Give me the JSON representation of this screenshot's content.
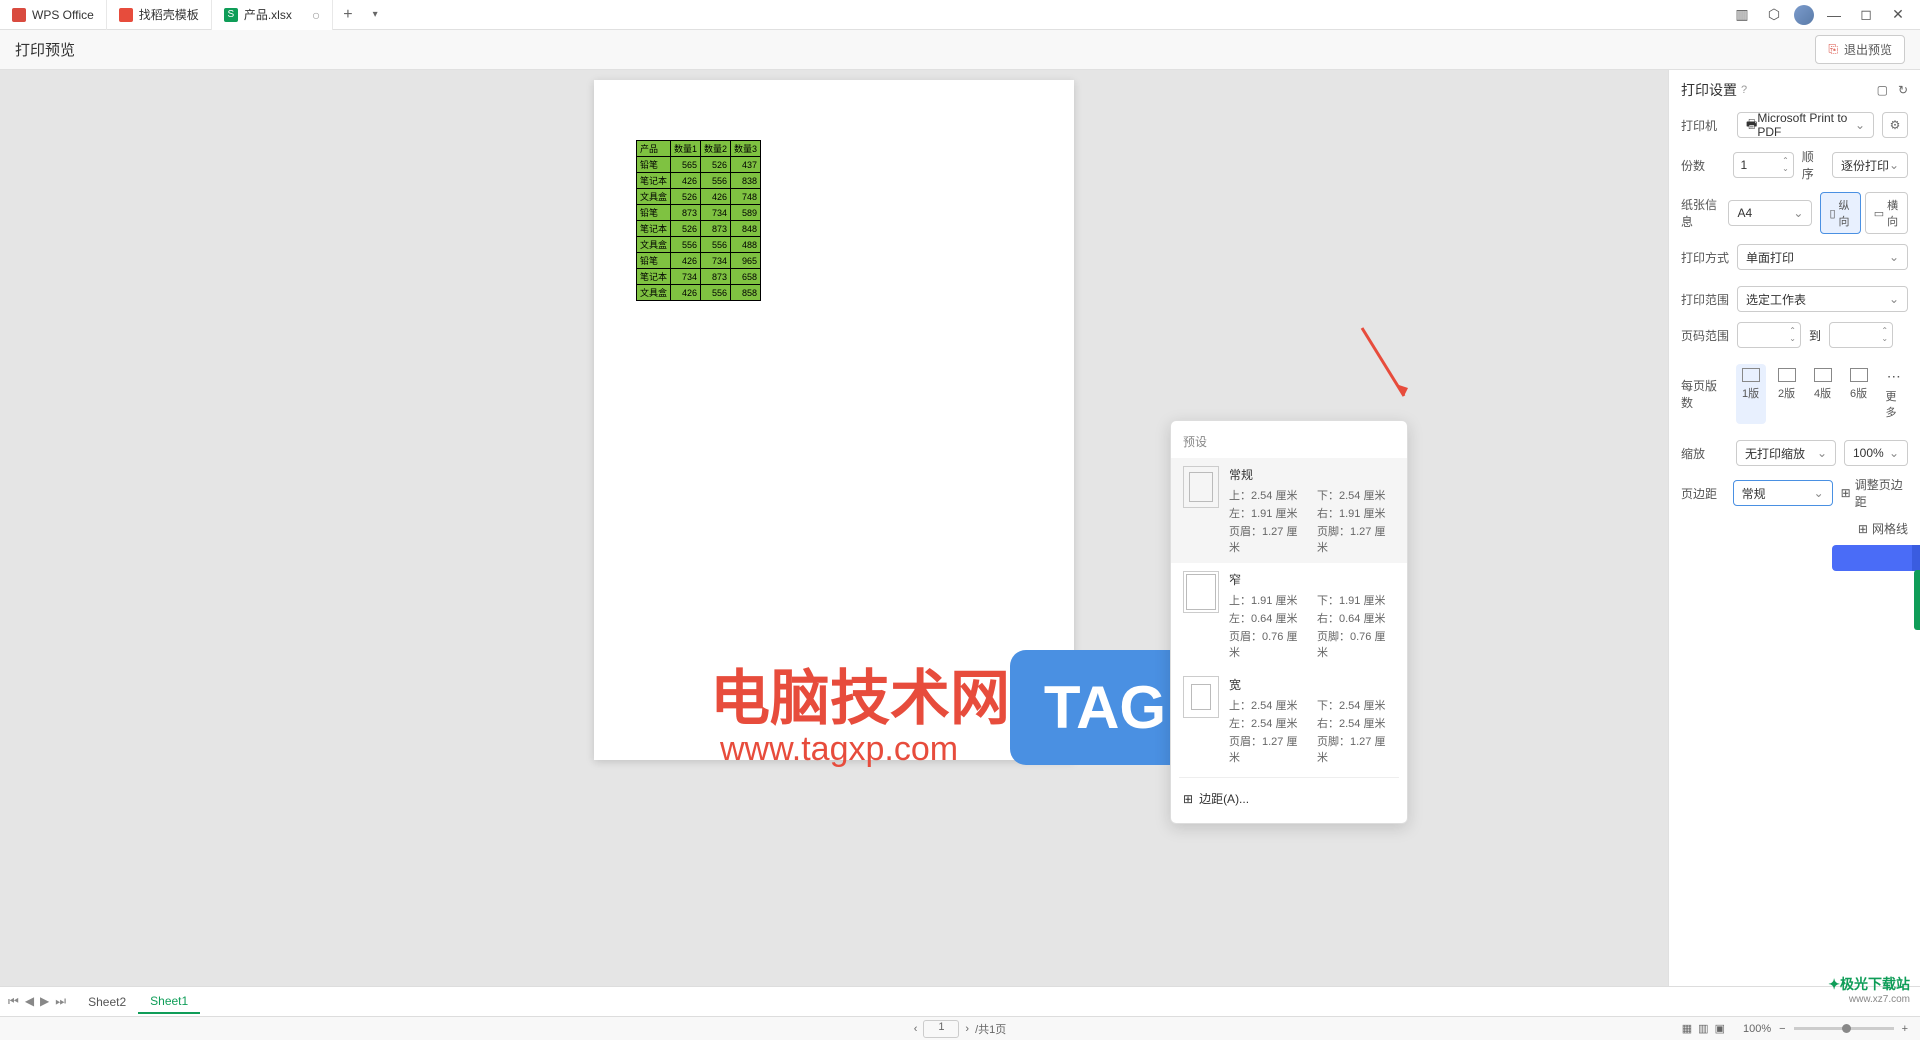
{
  "titlebar": {
    "app": "WPS Office",
    "tab2": "找稻壳模板",
    "tab3": "产品.xlsx"
  },
  "header": {
    "title": "打印预览",
    "exit": "退出预览"
  },
  "panel": {
    "title": "打印设置",
    "printer_label": "打印机",
    "printer": "Microsoft Print to PDF",
    "copies_label": "份数",
    "copies": "1",
    "order_label": "顺序",
    "order": "逐份打印",
    "paper_label": "纸张信息",
    "paper": "A4",
    "portrait": "纵向",
    "landscape": "横向",
    "mode_label": "打印方式",
    "mode": "单面打印",
    "range_label": "打印范围",
    "range": "选定工作表",
    "pages_label": "页码范围",
    "to": "到",
    "layouts_label": "每页版数",
    "l1": "1版",
    "l2": "2版",
    "l4": "4版",
    "l6": "6版",
    "lmore": "更多",
    "scale_label": "缩放",
    "scale": "无打印缩放",
    "zoom": "100%",
    "margin_label": "页边距",
    "margin": "常规",
    "margin_adj": "调整页边距",
    "grid": "网格线"
  },
  "dropdown": {
    "head": "预设",
    "normal": {
      "name": "常规",
      "t": "上：2.54 厘米",
      "b": "下：2.54 厘米",
      "l": "左：1.91 厘米",
      "r": "右：1.91 厘米",
      "h": "页眉：1.27 厘米",
      "f": "页脚：1.27 厘米"
    },
    "narrow": {
      "name": "窄",
      "t": "上：1.91 厘米",
      "b": "下：1.91 厘米",
      "l": "左：0.64 厘米",
      "r": "右：0.64 厘米",
      "h": "页眉：0.76 厘米",
      "f": "页脚：0.76 厘米"
    },
    "wide": {
      "name": "宽",
      "t": "上：2.54 厘米",
      "b": "下：2.54 厘米",
      "l": "左：2.54 厘米",
      "r": "右：2.54 厘米",
      "h": "页眉：1.27 厘米",
      "f": "页脚：1.27 厘米"
    },
    "custom": "边距(A)..."
  },
  "table": {
    "headers": [
      "产品",
      "数量1",
      "数量2",
      "数量3"
    ],
    "rows": [
      [
        "铅笔",
        "565",
        "526",
        "437"
      ],
      [
        "笔记本",
        "426",
        "556",
        "838"
      ],
      [
        "文具盒",
        "526",
        "426",
        "748"
      ],
      [
        "铅笔",
        "873",
        "734",
        "589"
      ],
      [
        "笔记本",
        "526",
        "873",
        "848"
      ],
      [
        "文具盒",
        "556",
        "556",
        "488"
      ],
      [
        "铅笔",
        "426",
        "734",
        "965"
      ],
      [
        "笔记本",
        "734",
        "873",
        "658"
      ],
      [
        "文具盒",
        "426",
        "556",
        "858"
      ]
    ]
  },
  "overlay": {
    "text": "电脑技术网",
    "url": "www.tagxp.com",
    "tag": "TAG"
  },
  "watermark": {
    "name": "极光下载站",
    "url": "www.xz7.com"
  },
  "sheets": {
    "s1": "Sheet2",
    "s2": "Sheet1"
  },
  "status": {
    "page": "1",
    "total": "/共1页",
    "zoom": "100%"
  }
}
